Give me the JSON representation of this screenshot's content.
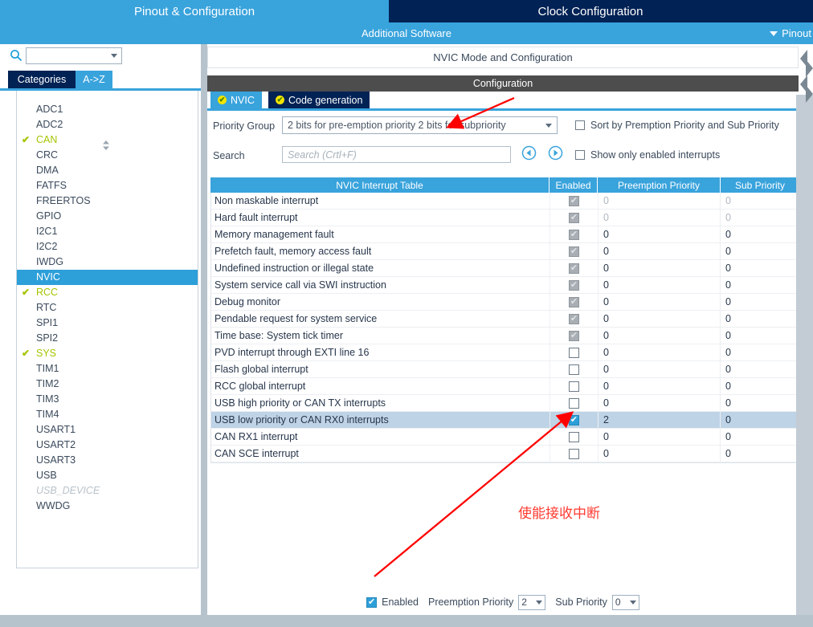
{
  "window": {
    "top_tabs": [
      {
        "label": "Pinout & Configuration",
        "state": "active"
      },
      {
        "label": "Clock Configuration",
        "state": "inactive"
      },
      {
        "label": "",
        "state": "inactive"
      }
    ],
    "additional_software": "Additional Software",
    "pinout_menu": "Pinout"
  },
  "sidebar": {
    "search_placeholder": "",
    "search_value": "",
    "gear_icon": "gear-icon",
    "tabs": [
      {
        "label": "Categories",
        "active": false
      },
      {
        "label": "A->Z",
        "active": true
      }
    ],
    "items": [
      {
        "label": "ADC1",
        "state": "normal",
        "check": false
      },
      {
        "label": "ADC2",
        "state": "normal",
        "check": false
      },
      {
        "label": "CAN",
        "state": "used",
        "check": true
      },
      {
        "label": "CRC",
        "state": "normal",
        "check": false
      },
      {
        "label": "DMA",
        "state": "normal",
        "check": false
      },
      {
        "label": "FATFS",
        "state": "normal",
        "check": false
      },
      {
        "label": "FREERTOS",
        "state": "normal",
        "check": false
      },
      {
        "label": "GPIO",
        "state": "normal",
        "check": false
      },
      {
        "label": "I2C1",
        "state": "normal",
        "check": false
      },
      {
        "label": "I2C2",
        "state": "normal",
        "check": false
      },
      {
        "label": "IWDG",
        "state": "normal",
        "check": false
      },
      {
        "label": "NVIC",
        "state": "selected",
        "check": false
      },
      {
        "label": "RCC",
        "state": "used",
        "check": true
      },
      {
        "label": "RTC",
        "state": "normal",
        "check": false
      },
      {
        "label": "SPI1",
        "state": "normal",
        "check": false
      },
      {
        "label": "SPI2",
        "state": "normal",
        "check": false
      },
      {
        "label": "SYS",
        "state": "used",
        "check": true
      },
      {
        "label": "TIM1",
        "state": "normal",
        "check": false
      },
      {
        "label": "TIM2",
        "state": "normal",
        "check": false
      },
      {
        "label": "TIM3",
        "state": "normal",
        "check": false
      },
      {
        "label": "TIM4",
        "state": "normal",
        "check": false
      },
      {
        "label": "USART1",
        "state": "normal",
        "check": false
      },
      {
        "label": "USART2",
        "state": "normal",
        "check": false
      },
      {
        "label": "USART3",
        "state": "normal",
        "check": false
      },
      {
        "label": "USB",
        "state": "normal",
        "check": false
      },
      {
        "label": "USB_DEVICE",
        "state": "greyed",
        "check": false
      },
      {
        "label": "WWDG",
        "state": "normal",
        "check": false
      }
    ]
  },
  "main": {
    "mode_header": "NVIC Mode and Configuration",
    "config_header": "Configuration",
    "config_tabs": [
      {
        "label": "NVIC",
        "active": true
      },
      {
        "label": "Code generation",
        "active": false
      }
    ],
    "priority_group_label": "Priority Group",
    "priority_group_value": "2 bits for pre-emption priority 2 bits for subpriority",
    "search_label": "Search",
    "search_placeholder": "Search (Crtl+F)",
    "sort_checkbox_label": "Sort by Premption Priority and Sub Priority",
    "sort_checkbox_checked": false,
    "show_enabled_checkbox_label": "Show only enabled interrupts",
    "show_enabled_checked": false,
    "table": {
      "headers": [
        "NVIC Interrupt Table",
        "Enabled",
        "Preemption Priority",
        "Sub Priority"
      ],
      "rows": [
        {
          "name": "Non maskable interrupt",
          "enabled": "locked",
          "pre": "0",
          "sub": "0",
          "dim": true,
          "highlight": false
        },
        {
          "name": "Hard fault interrupt",
          "enabled": "locked",
          "pre": "0",
          "sub": "0",
          "dim": true,
          "highlight": false
        },
        {
          "name": "Memory management fault",
          "enabled": "locked",
          "pre": "0",
          "sub": "0",
          "dim": false,
          "highlight": false
        },
        {
          "name": "Prefetch fault, memory access fault",
          "enabled": "locked",
          "pre": "0",
          "sub": "0",
          "dim": false,
          "highlight": false
        },
        {
          "name": "Undefined instruction or illegal state",
          "enabled": "locked",
          "pre": "0",
          "sub": "0",
          "dim": false,
          "highlight": false
        },
        {
          "name": "System service call via SWI instruction",
          "enabled": "locked",
          "pre": "0",
          "sub": "0",
          "dim": false,
          "highlight": false
        },
        {
          "name": "Debug monitor",
          "enabled": "locked",
          "pre": "0",
          "sub": "0",
          "dim": false,
          "highlight": false
        },
        {
          "name": "Pendable request for system service",
          "enabled": "locked",
          "pre": "0",
          "sub": "0",
          "dim": false,
          "highlight": false
        },
        {
          "name": "Time base: System tick timer",
          "enabled": "locked",
          "pre": "0",
          "sub": "0",
          "dim": false,
          "highlight": false
        },
        {
          "name": "PVD interrupt through EXTI line 16",
          "enabled": "off",
          "pre": "0",
          "sub": "0",
          "dim": false,
          "highlight": false
        },
        {
          "name": "Flash global interrupt",
          "enabled": "off",
          "pre": "0",
          "sub": "0",
          "dim": false,
          "highlight": false
        },
        {
          "name": "RCC global interrupt",
          "enabled": "off",
          "pre": "0",
          "sub": "0",
          "dim": false,
          "highlight": false
        },
        {
          "name": "USB high priority or CAN TX interrupts",
          "enabled": "off",
          "pre": "0",
          "sub": "0",
          "dim": false,
          "highlight": false
        },
        {
          "name": "USB low priority or CAN RX0 interrupts",
          "enabled": "on",
          "pre": "2",
          "sub": "0",
          "dim": false,
          "highlight": true
        },
        {
          "name": "CAN RX1 interrupt",
          "enabled": "off",
          "pre": "0",
          "sub": "0",
          "dim": false,
          "highlight": false
        },
        {
          "name": "CAN SCE interrupt",
          "enabled": "off",
          "pre": "0",
          "sub": "0",
          "dim": false,
          "highlight": false
        }
      ]
    },
    "bottom": {
      "enabled_label": "Enabled",
      "enabled_checked": true,
      "preemption_label": "Preemption Priority",
      "preemption_value": "2",
      "sub_label": "Sub Priority",
      "sub_value": "0"
    }
  },
  "annotations": {
    "note_text": "使能接收中断",
    "note_color": "#ff3b30"
  }
}
